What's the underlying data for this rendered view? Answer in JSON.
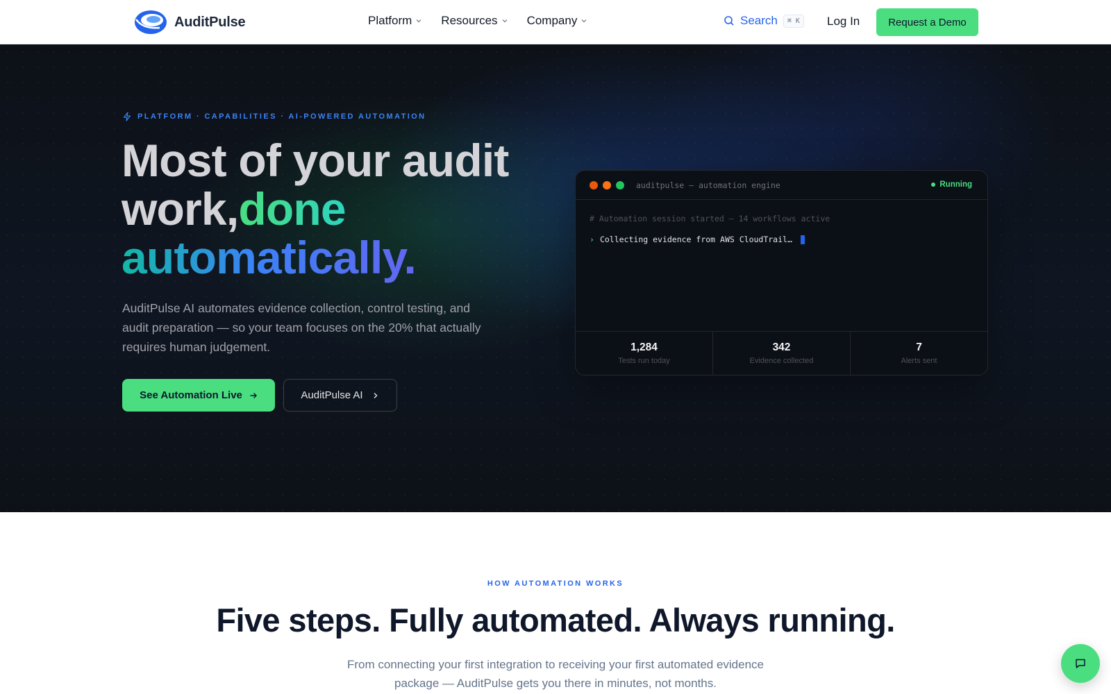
{
  "brand": {
    "name": "AuditPulse"
  },
  "nav": {
    "items": [
      {
        "label": "Platform"
      },
      {
        "label": "Resources"
      },
      {
        "label": "Company"
      }
    ],
    "search_label": "Search",
    "search_shortcut": "⌘ K",
    "login_label": "Log In",
    "demo_label": "Request a Demo"
  },
  "hero": {
    "eyebrow": "PLATFORM · CAPABILITIES · AI-POWERED AUTOMATION",
    "headline_part1": "Most of your audit work,",
    "headline_part2": "done",
    "headline_part3": "automatically.",
    "subtext": "AuditPulse AI automates evidence collection, control testing, and audit preparation — so your team focuses on the 20% that actually requires human judgement.",
    "cta_primary": "See Automation Live",
    "cta_secondary": "AuditPulse AI"
  },
  "terminal": {
    "title": "auditpulse — automation engine",
    "status": "Running",
    "comment_line": "# Automation session started — 14 workflows active",
    "command_line": "Collecting evidence from AWS CloudTrail…",
    "stats": [
      {
        "value": "1,284",
        "label": "Tests run today"
      },
      {
        "value": "342",
        "label": "Evidence collected"
      },
      {
        "value": "7",
        "label": "Alerts sent"
      }
    ]
  },
  "how": {
    "eyebrow": "HOW AUTOMATION WORKS",
    "title": "Five steps. Fully automated. Always running.",
    "subtext": "From connecting your first integration to receiving your first automated evidence package — AuditPulse gets you there in minutes, not months."
  },
  "colors": {
    "accent_green": "#4ade80",
    "accent_blue": "#2563eb",
    "hero_bg": "#0d1117"
  }
}
